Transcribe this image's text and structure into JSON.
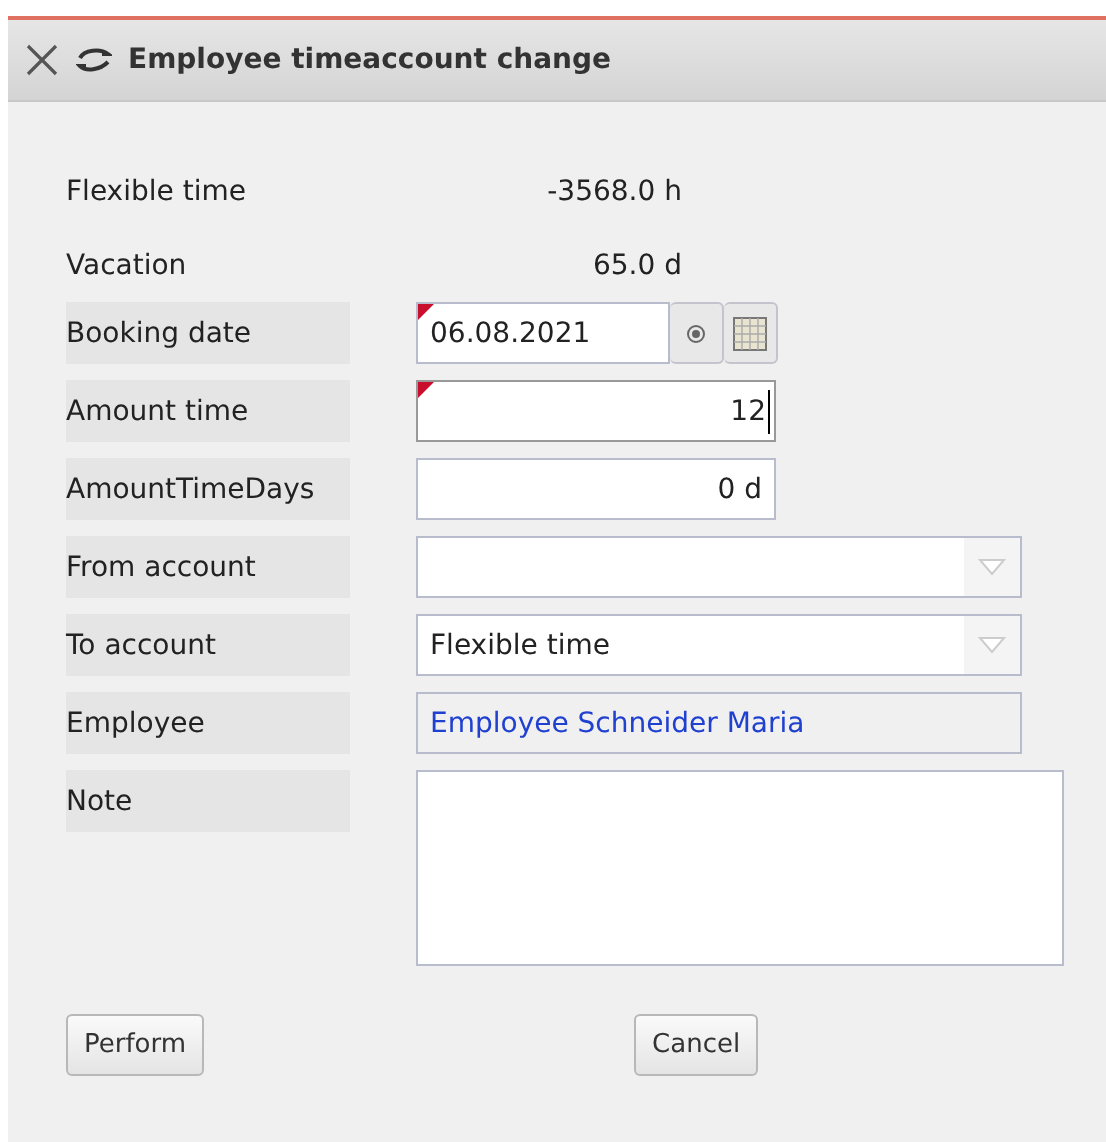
{
  "window": {
    "title": "Employee timeaccount change"
  },
  "summary": [
    {
      "label": "Flexible time",
      "value": "-3568.0 h"
    },
    {
      "label": "Vacation",
      "value": "65.0 d"
    }
  ],
  "fields": [
    {
      "kind": "date",
      "label": "Booking date",
      "value": "06.08.2021",
      "flagged": true
    },
    {
      "kind": "number",
      "label": "Amount time",
      "value": "12",
      "flagged": true,
      "focused": true
    },
    {
      "kind": "number",
      "label": "AmountTimeDays",
      "value": "0 d",
      "flagged": false,
      "focused": false
    },
    {
      "kind": "combo",
      "label": "From account"
    },
    {
      "kind": "combo",
      "label": "To account",
      "value": "Flexible time"
    },
    {
      "kind": "link",
      "label": "Employee",
      "value": "Employee Schneider Maria"
    },
    {
      "kind": "textarea",
      "label": "Note"
    }
  ],
  "buttons": [
    "Perform",
    "Cancel"
  ]
}
